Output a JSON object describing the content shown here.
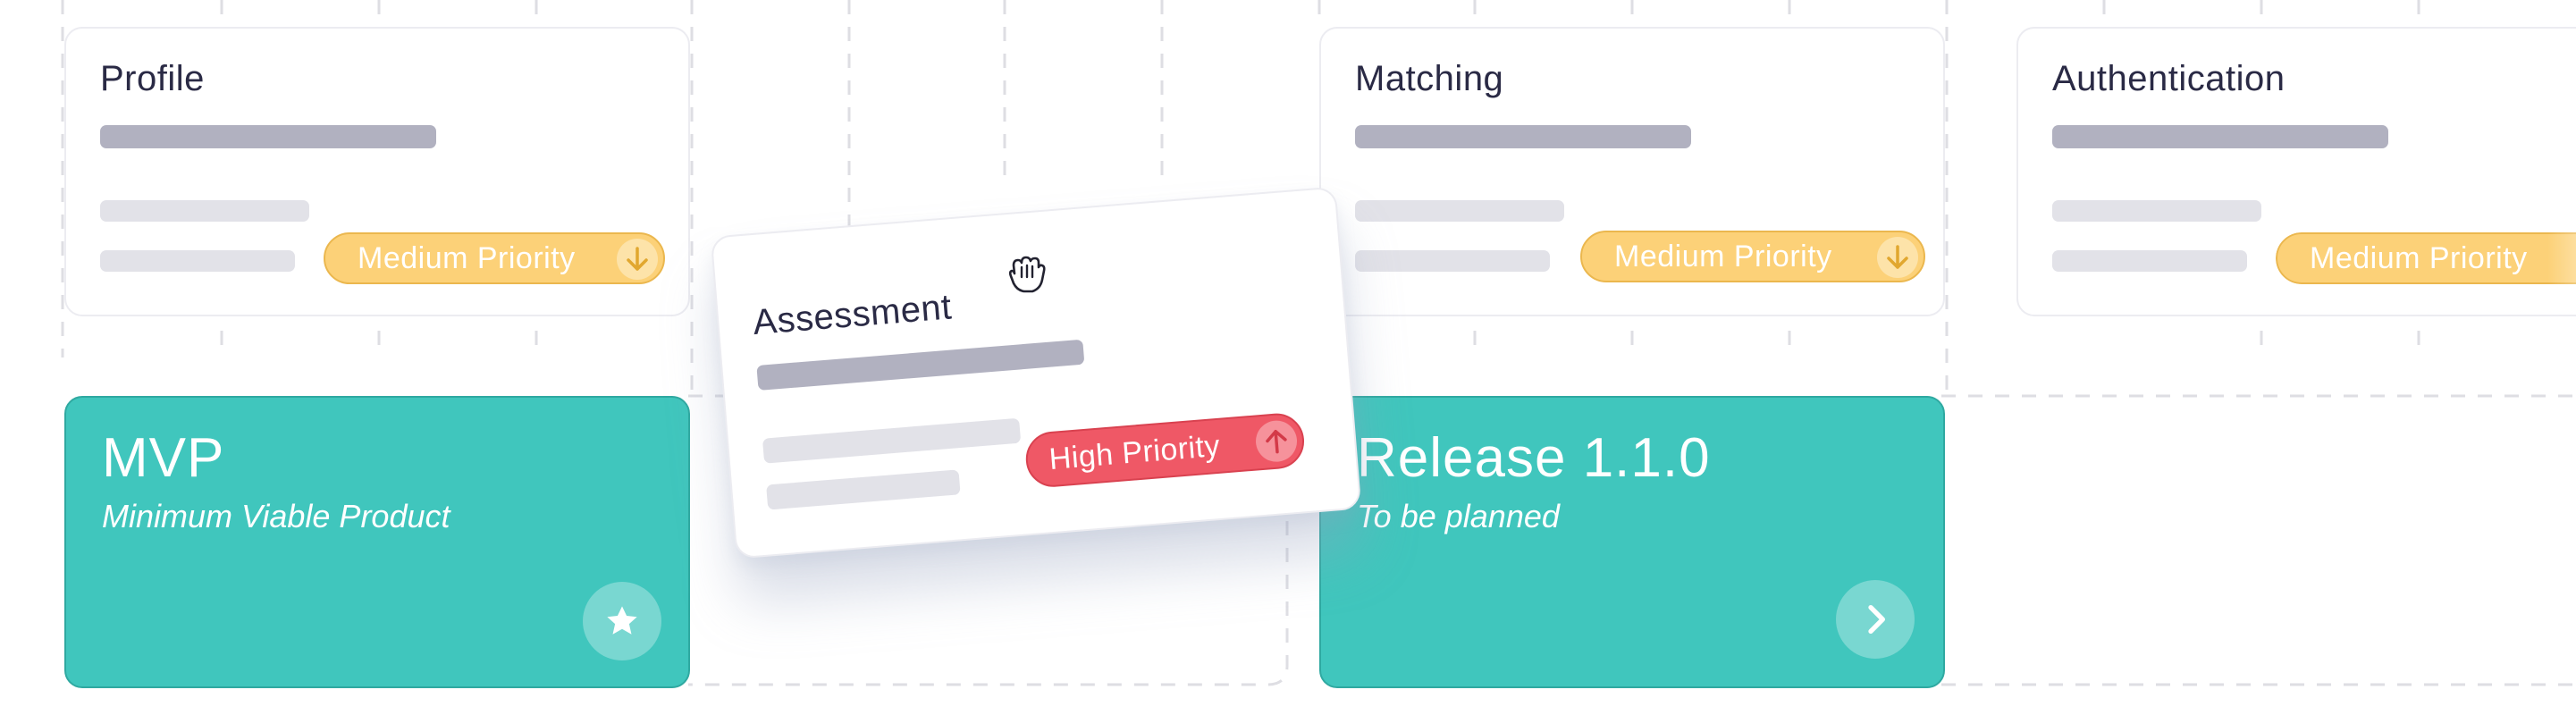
{
  "feature_cards": [
    {
      "title": "Profile",
      "priority": "Medium Priority"
    },
    {
      "title": "Matching",
      "priority": "Medium Priority"
    },
    {
      "title": "Authentication",
      "priority": "Medium Priority"
    }
  ],
  "dragged_card": {
    "title": "Assessment",
    "priority": "High Priority"
  },
  "releases": [
    {
      "title": "MVP",
      "subtitle": "Minimum Viable Product",
      "action_icon": "star-icon"
    },
    {
      "title": "Release 1.1.0",
      "subtitle": "To be planned",
      "action_icon": "chevron-right-icon"
    }
  ],
  "colors": {
    "release_teal": "#40c6bd",
    "medium_priority": "#fcd178",
    "high_priority": "#ef5866",
    "title_text": "#2a2a45",
    "skeleton_dark": "#b1b1c0",
    "skeleton_light": "#e2e2e8"
  },
  "icons": {
    "medium_priority": "arrow-down-icon",
    "high_priority": "arrow-up-icon",
    "cursor": "grab-hand-cursor-icon"
  }
}
